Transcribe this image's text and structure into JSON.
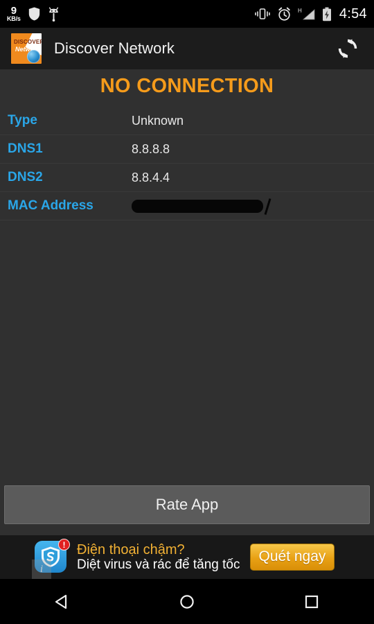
{
  "status_bar": {
    "net_speed_value": "9",
    "net_speed_unit": "KB/s",
    "shield_icon": "shield-icon",
    "android_icon": "android-bug-icon",
    "vibrate_icon": "vibrate-icon",
    "alarm_icon": "alarm-clock-icon",
    "signal_label": "H",
    "signal_icon": "signal-triangle-icon",
    "battery_icon": "battery-charging-icon",
    "clock": "4:54"
  },
  "app_bar": {
    "logo_line1": "DISCOVER",
    "logo_line2": "Network",
    "logo_icon": "app-logo-globe-icon",
    "title": "Discover Network",
    "refresh_icon": "refresh-icon"
  },
  "content": {
    "headline": "NO CONNECTION",
    "headline_color": "#f59b1b",
    "label_color": "#2aa6e8",
    "rows": [
      {
        "label": "Type",
        "value": "Unknown",
        "redacted": false
      },
      {
        "label": "DNS1",
        "value": "8.8.8.8",
        "redacted": false
      },
      {
        "label": "DNS2",
        "value": "8.8.4.4",
        "redacted": false
      },
      {
        "label": "MAC Address",
        "value": "",
        "redacted": true
      }
    ]
  },
  "footer": {
    "rate_button_label": "Rate App"
  },
  "ad": {
    "shield_icon": "ad-shield-icon",
    "badge": "!",
    "line1": "Điện thoại chậm?",
    "line2": "Diệt virus và rác để tăng tốc",
    "cta_label": "Quét ngay",
    "info_badge": "i"
  },
  "nav_bar": {
    "back_icon": "nav-back-icon",
    "home_icon": "nav-home-icon",
    "recents_icon": "nav-recents-icon"
  }
}
